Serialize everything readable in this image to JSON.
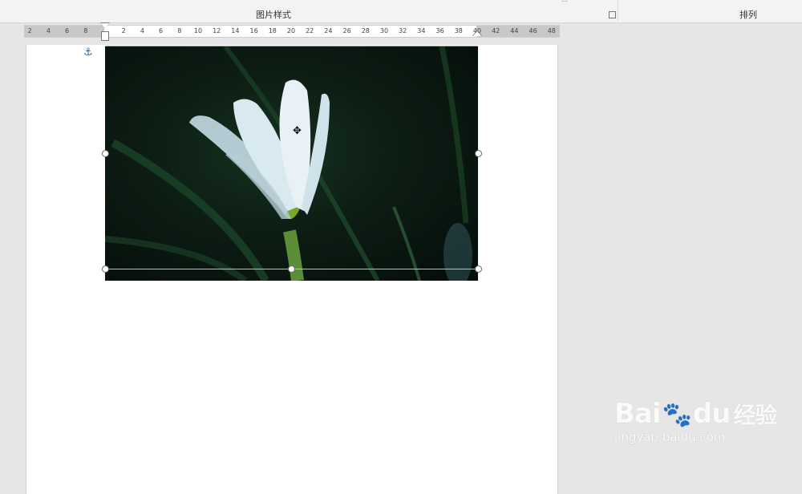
{
  "ribbon": {
    "group_picture_styles": "图片样式",
    "group_arrange": "排列"
  },
  "ruler": {
    "left_ticks": [
      "8",
      "6",
      "4",
      "2"
    ],
    "right_ticks": [
      "2",
      "4",
      "6",
      "8",
      "10",
      "12",
      "14",
      "16",
      "18",
      "20",
      "22",
      "24",
      "26",
      "28",
      "30",
      "32",
      "34",
      "36",
      "38",
      "40",
      "42",
      "44",
      "46",
      "48"
    ]
  },
  "watermark": {
    "logo": "Bai",
    "logo2": "du",
    "logo_cn": "经验",
    "url": "jingyan.baidu.com"
  },
  "colors": {
    "anchor": "#2e5e9e",
    "page": "#ffffff",
    "workspace": "#e6e6e6"
  }
}
